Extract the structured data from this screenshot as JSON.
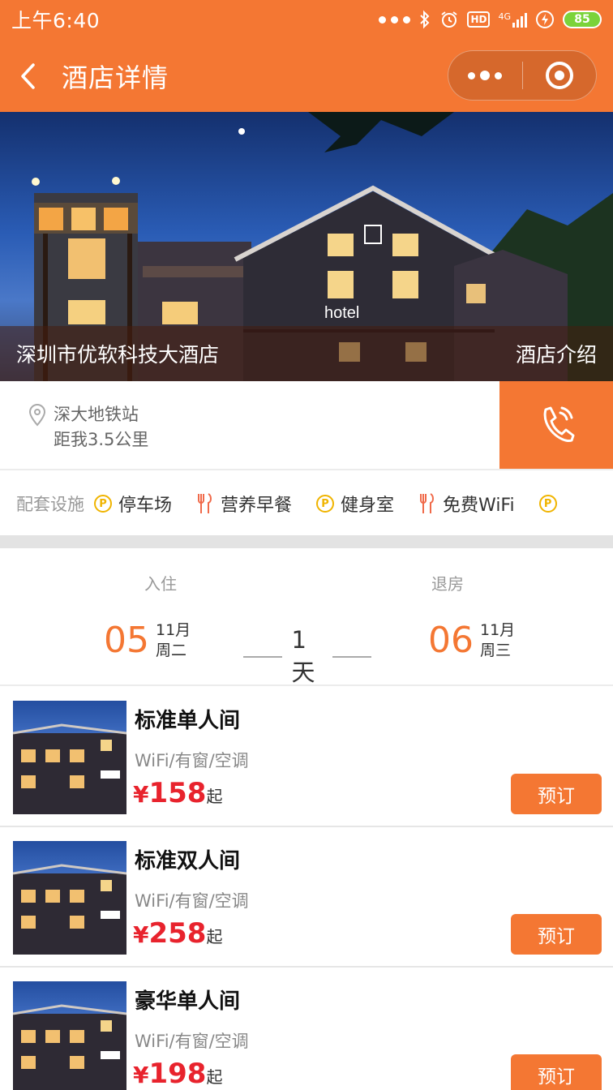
{
  "status_bar": {
    "time": "上午6:40",
    "network": "4G",
    "battery": "85"
  },
  "nav": {
    "title": "酒店详情"
  },
  "hero": {
    "hotel_name": "深圳市优软科技大酒店",
    "intro_link": "酒店介绍",
    "sign_text": "hotel"
  },
  "location": {
    "station": "深大地铁站",
    "distance": "距我3.5公里"
  },
  "facilities": {
    "label": "配套设施",
    "items": [
      {
        "icon": "parking-icon",
        "label": "停车场"
      },
      {
        "icon": "fork-knife-icon",
        "label": "营养早餐"
      },
      {
        "icon": "parking-icon",
        "label": "健身室"
      },
      {
        "icon": "fork-knife-icon",
        "label": "免费WiFi"
      }
    ]
  },
  "dates": {
    "checkin_label": "入住",
    "checkout_label": "退房",
    "checkin": {
      "day": "05",
      "month": "11月",
      "weekday": "周二"
    },
    "checkout": {
      "day": "06",
      "month": "11月",
      "weekday": "周三"
    },
    "nights": "1天"
  },
  "rooms": [
    {
      "name": "标准单人间",
      "features": "WiFi/有窗/空调",
      "currency": "¥",
      "price": "158",
      "suffix": "起",
      "button": "预订"
    },
    {
      "name": "标准双人间",
      "features": "WiFi/有窗/空调",
      "currency": "¥",
      "price": "258",
      "suffix": "起",
      "button": "预订"
    },
    {
      "name": "豪华单人间",
      "features": "WiFi/有窗/空调",
      "currency": "¥",
      "price": "198",
      "suffix": "起",
      "button": "预订"
    }
  ],
  "colors": {
    "accent": "#f47733",
    "price": "#e8232d"
  }
}
